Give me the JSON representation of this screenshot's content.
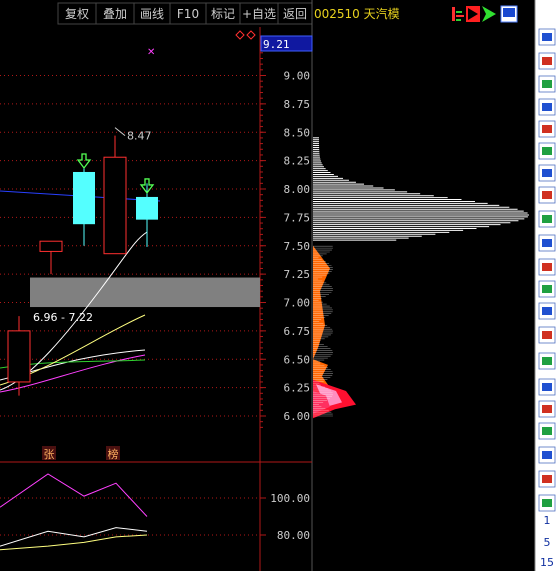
{
  "toolbar": {
    "buttons": [
      "复权",
      "叠加",
      "画线",
      "F10",
      "标记",
      "+自选",
      "返回"
    ],
    "stock_title": "002510 天汽模"
  },
  "colors": {
    "background": "#000000",
    "grid_red": "#b01818",
    "axis_text": "#cccccc",
    "title_yellow": "#e8d21e",
    "bull_outline": "#ff3030",
    "bear_fill": "#54ffff",
    "ma_white": "#ffffff",
    "ma_yellow": "#ffff80",
    "ma_magenta": "#ff40ff",
    "ma_green": "#30d030",
    "ma_blue": "#2840ff",
    "highlight_zone": "#808080",
    "price_box_bg": "#1018a0",
    "side_panel_bg": "#ffffff"
  },
  "current_price_label": "9.21",
  "chart_data": [
    {
      "type": "candlestick",
      "title": "",
      "y_ticks": [
        "9.00",
        "8.75",
        "8.50",
        "8.25",
        "8.00",
        "7.75",
        "7.50",
        "7.25",
        "7.00",
        "6.75",
        "6.50",
        "6.25",
        "6.00"
      ],
      "ylim": [
        5.78,
        9.45
      ],
      "candles": [
        {
          "open": 6.3,
          "close": 6.75,
          "high": 6.88,
          "low": 6.18,
          "direction": "up"
        },
        {
          "open": 7.45,
          "close": 7.54,
          "high": 7.54,
          "low": 7.25,
          "direction": "up"
        },
        {
          "open": 7.69,
          "close": 8.15,
          "high": 8.19,
          "low": 7.5,
          "direction": "down"
        },
        {
          "open": 7.43,
          "close": 8.28,
          "high": 8.47,
          "low": 7.43,
          "direction": "up"
        },
        {
          "open": 7.73,
          "close": 7.93,
          "high": 8.05,
          "low": 7.49,
          "direction": "down"
        }
      ],
      "annotations": [
        {
          "text": "8.47",
          "price": 8.47,
          "note": "high"
        },
        {
          "text": "6.96 - 7.22",
          "price_low": 6.96,
          "price_high": 7.22,
          "note": "gap zone"
        }
      ],
      "signal_markers": [
        {
          "candle_index": 2,
          "type": "down-arrow",
          "color": "#54ff54"
        },
        {
          "candle_index": 4,
          "type": "down-arrow",
          "color": "#54ff54"
        }
      ],
      "moving_averages": [
        {
          "color": "#ffffff",
          "points": [
            [
              3.7,
              7.41
            ],
            [
              4.0,
              7.61
            ]
          ]
        },
        {
          "color": "#2840ff",
          "points": [
            [
              -0.5,
              7.97
            ],
            [
              4.0,
              7.9
            ]
          ]
        }
      ],
      "chip_distribution": {
        "profit_region_color": "#ffffff",
        "loss_region_colors": [
          "#ff6600",
          "#ff3060",
          "#ff8ec0",
          "#ff1030"
        ],
        "peak_price": 7.77
      }
    },
    {
      "type": "line",
      "title": "",
      "y_ticks": [
        "100.00",
        "80.00"
      ],
      "ylim": [
        60,
        120
      ],
      "series": [
        {
          "color": "#ff40ff",
          "values": [
            95,
            113,
            101,
            108,
            90
          ]
        },
        {
          "color": "#ffffff",
          "values": [
            74,
            82,
            79,
            84,
            82
          ]
        },
        {
          "color": "#ffff80",
          "values": [
            72,
            74,
            76,
            79,
            80
          ]
        }
      ]
    }
  ],
  "bottom_markers": [
    "张",
    "榜"
  ],
  "side_panel": {
    "icons": [
      "close-icon",
      "arrow-up-icon",
      "arrow-down-icon",
      "list-icon",
      "grid-icon",
      "line-chart-icon",
      "candlestick-icon",
      "document-icon",
      "fio-icon",
      "f10-icon",
      "news-icon",
      "fiz-icon",
      "7d-icon",
      "circle-icon",
      "wave-icon",
      "rsi-icon",
      "s-icon",
      "move-icon",
      "pencil-icon",
      "f5-icon",
      "window-icon"
    ],
    "labels": [
      "Fio",
      "RSI",
      "S",
      "F5",
      "1",
      "5",
      "15"
    ]
  }
}
